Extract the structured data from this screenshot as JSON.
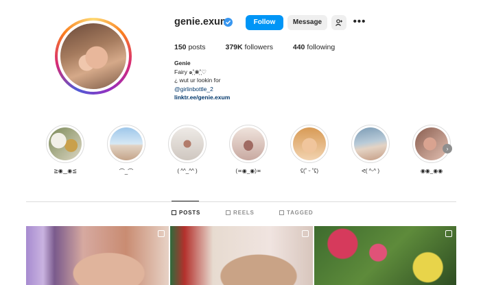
{
  "profile": {
    "username": "genie.exum",
    "verified": true,
    "follow_label": "Follow",
    "message_label": "Message",
    "suggest_icon": "add-person-icon",
    "more_label": "•••",
    "stats": {
      "posts_count": "150",
      "posts_label": "posts",
      "followers_count": "379K",
      "followers_label": "followers",
      "following_count": "440",
      "following_label": "following"
    },
    "bio": {
      "name": "Genie",
      "line1": "Fairy ๑˚̣̣̣͙❀˚̣̣̣͙♡",
      "line2": "¿ wut ur lookin for",
      "mention": "@girlinbottle_2",
      "link": "linktr.ee/genie.exum"
    }
  },
  "highlights": [
    {
      "label": "≧◉‿◉≦"
    },
    {
      "label": "⌒_⌒"
    },
    {
      "label": "( ^^_^^ )"
    },
    {
      "label": "(≖◉_◉)≖"
    },
    {
      "label": "ʢ(˚ ᵕ ˚ʢ)"
    },
    {
      "label": "ᕙ( ^ᵕ^ )"
    },
    {
      "label": "◉◉_◉◉"
    }
  ],
  "tabs": {
    "posts": "POSTS",
    "reels": "REELS",
    "tagged": "TAGGED"
  },
  "colors": {
    "follow_blue": "#0095f6",
    "verified_blue": "#3897f0",
    "link_blue": "#00376b"
  }
}
